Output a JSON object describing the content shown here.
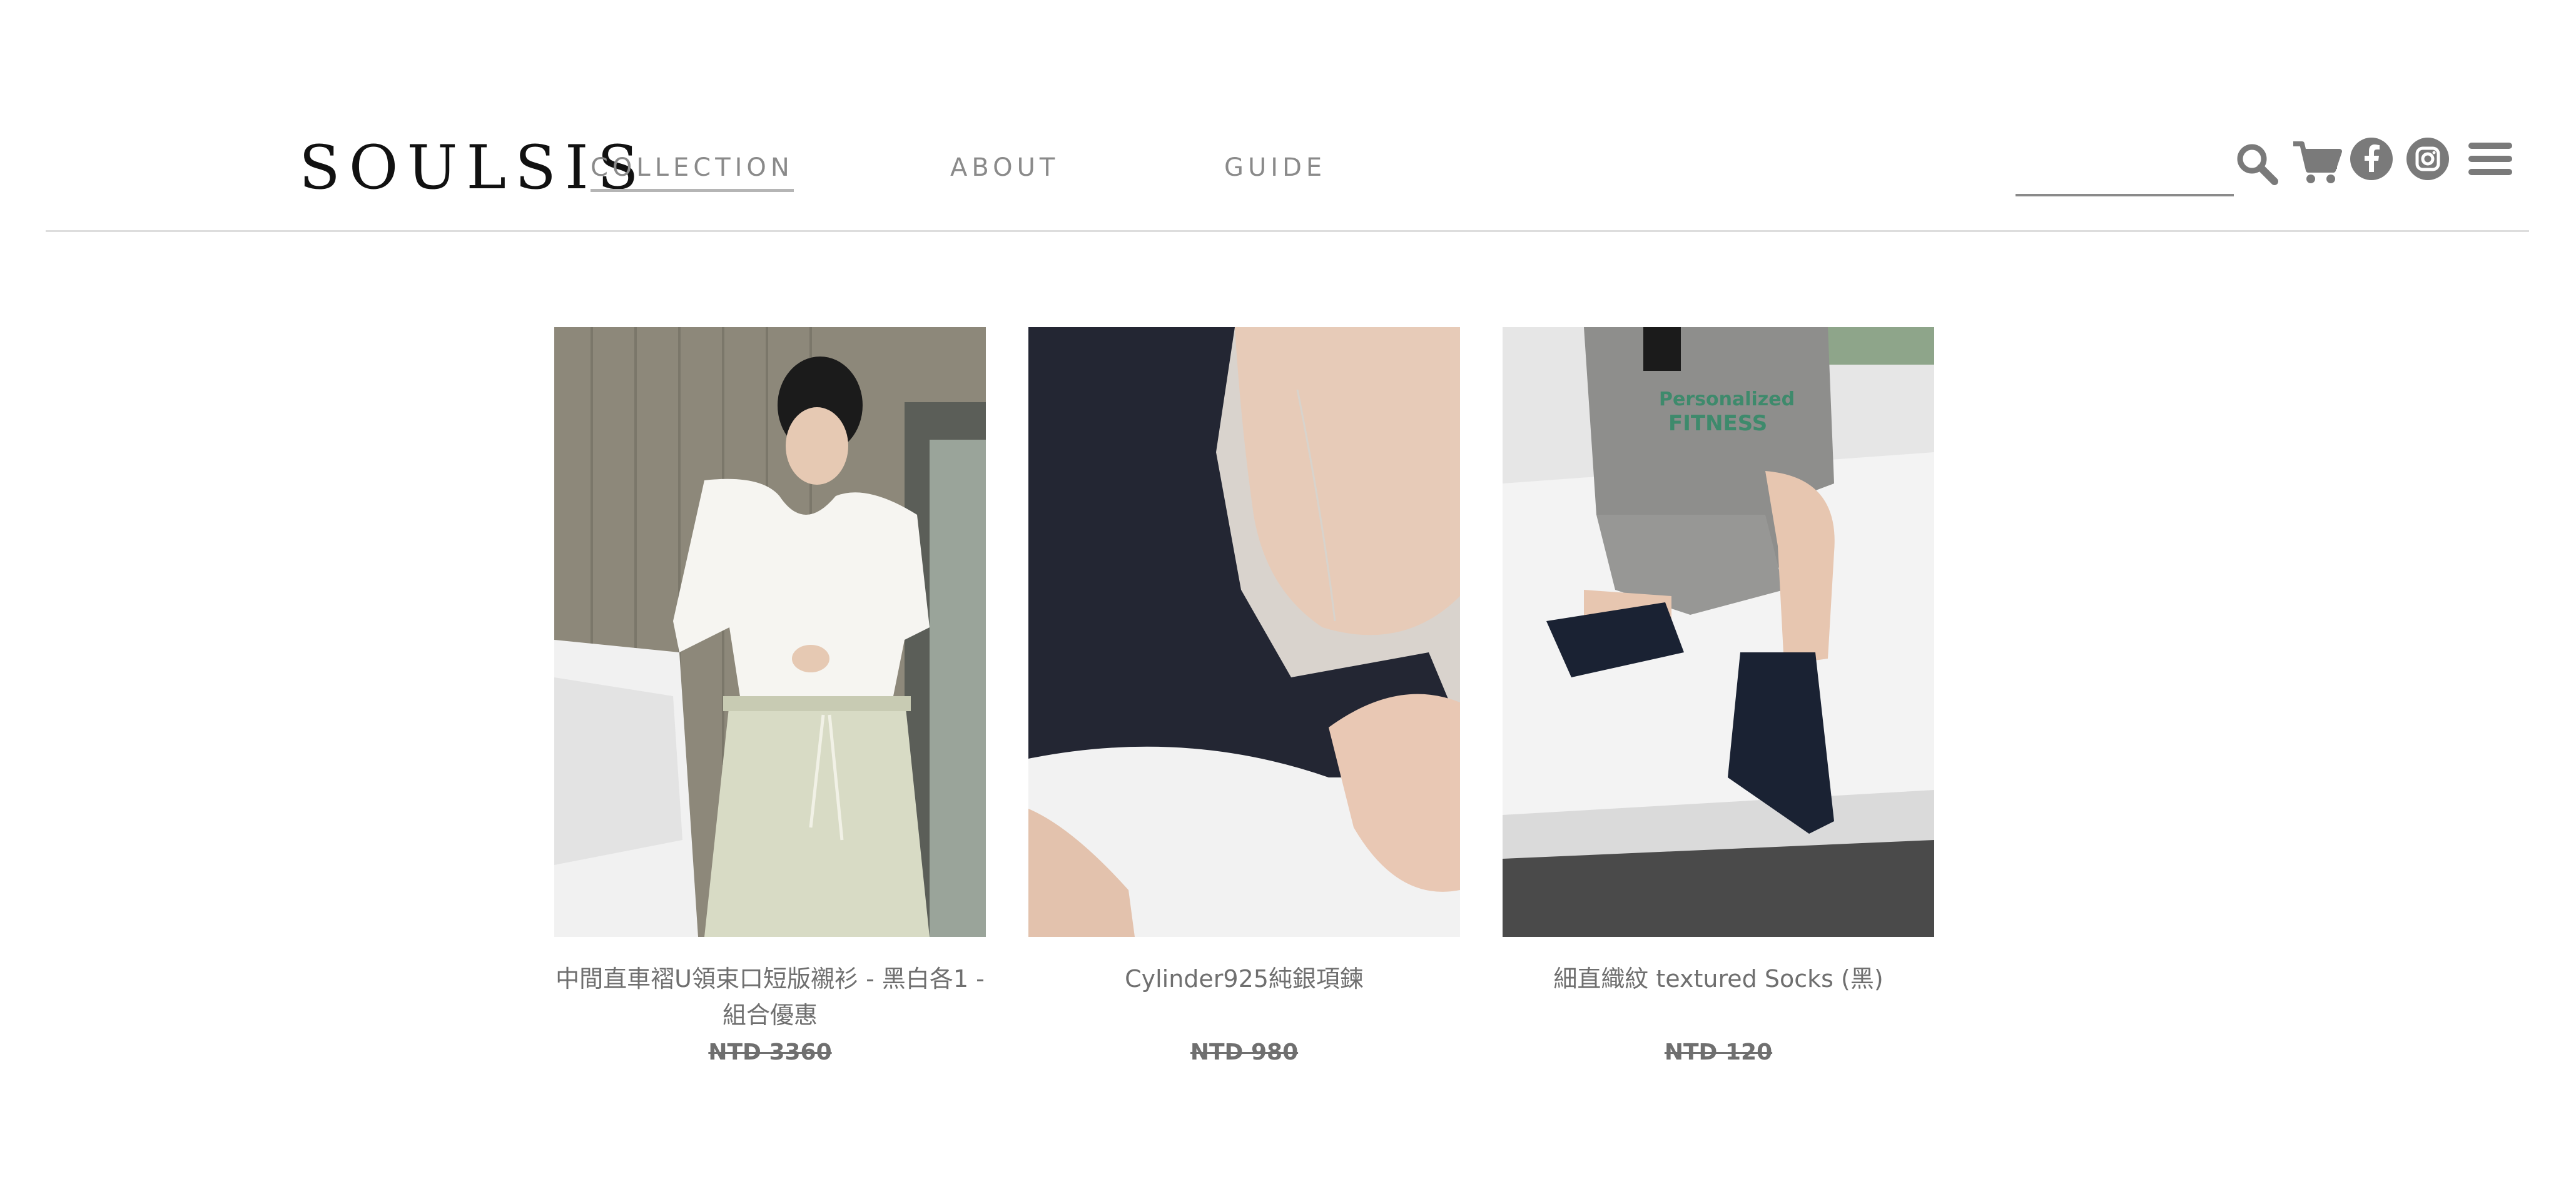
{
  "brand": {
    "logo": "SOULSIS"
  },
  "nav": {
    "items": [
      "COLLECTION",
      "ABOUT",
      "GUIDE"
    ],
    "active": "COLLECTION"
  },
  "search": {
    "value": "",
    "placeholder": ""
  },
  "icons": [
    "search-icon",
    "cart-icon",
    "facebook-icon",
    "instagram-icon",
    "menu-icon"
  ],
  "products": [
    {
      "name": "中間直車褶U領束口短版襯衫 - 黑白各1 - 組合優惠",
      "price": "NTD 3360"
    },
    {
      "name": "Cylinder925純銀項鍊",
      "price": "NTD 980"
    },
    {
      "name": "細直織紋 textured Socks (黑)",
      "price": "NTD 120"
    }
  ],
  "colors": {
    "nav_text": "#8a8a8a",
    "product_text": "#6f6f6f",
    "logo": "#111111",
    "divider": "#dddddd"
  }
}
